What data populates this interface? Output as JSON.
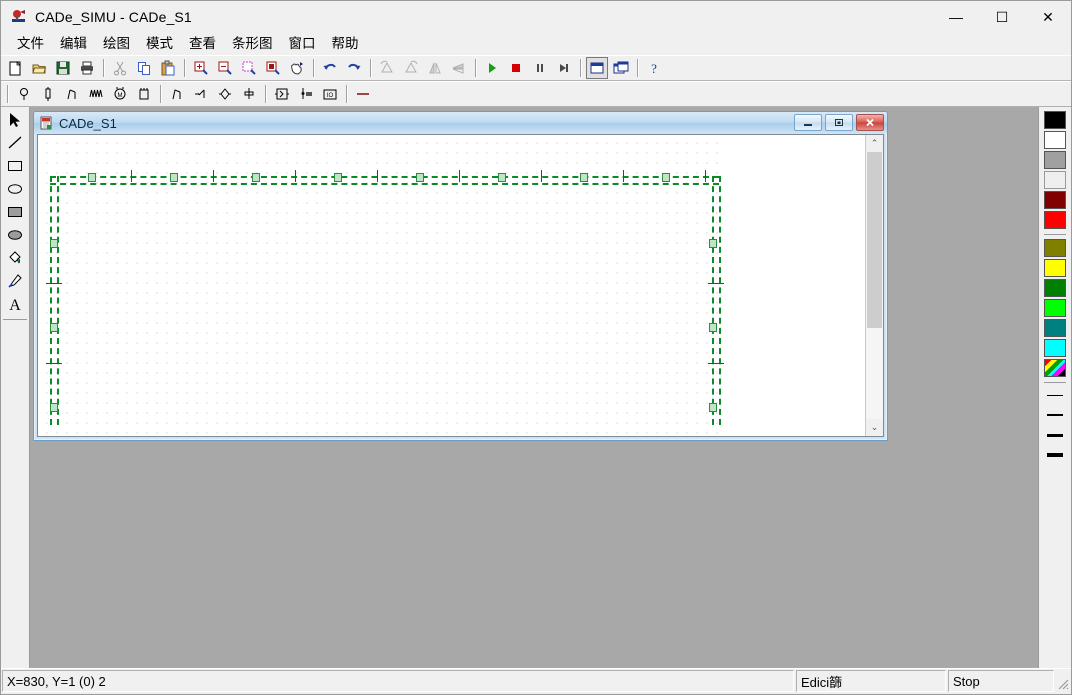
{
  "window": {
    "title": "CADe_SIMU - CADe_S1",
    "icon": "cade-simu-app-icon",
    "controls": {
      "minimize": "—",
      "maximize": "☐",
      "close": "✕"
    }
  },
  "menubar": {
    "items": [
      {
        "label": "文件",
        "name": "menu-file"
      },
      {
        "label": "编辑",
        "name": "menu-edit"
      },
      {
        "label": "绘图",
        "name": "menu-draw"
      },
      {
        "label": "模式",
        "name": "menu-mode"
      },
      {
        "label": "查看",
        "name": "menu-view"
      },
      {
        "label": "条形图",
        "name": "menu-bar-chart"
      },
      {
        "label": "窗口",
        "name": "menu-window"
      },
      {
        "label": "帮助",
        "name": "menu-help"
      }
    ]
  },
  "toolbar_main": {
    "buttons": [
      {
        "name": "new-icon",
        "tip": "New"
      },
      {
        "name": "open-icon",
        "tip": "Open"
      },
      {
        "name": "save-icon",
        "tip": "Save"
      },
      {
        "name": "print-icon",
        "tip": "Print"
      },
      {
        "name": "cut-icon",
        "tip": "Cut",
        "disabled": true
      },
      {
        "name": "copy-icon",
        "tip": "Copy"
      },
      {
        "name": "paste-icon",
        "tip": "Paste"
      },
      {
        "name": "zoom-in-icon",
        "tip": "Zoom In"
      },
      {
        "name": "zoom-out-icon",
        "tip": "Zoom Out"
      },
      {
        "name": "zoom-area-icon",
        "tip": "Zoom Area"
      },
      {
        "name": "zoom-page-icon",
        "tip": "Zoom Page"
      },
      {
        "name": "pan-icon",
        "tip": "Pan"
      },
      {
        "name": "undo-icon",
        "tip": "Undo"
      },
      {
        "name": "redo-icon",
        "tip": "Redo"
      },
      {
        "name": "rotate-left-icon",
        "tip": "Rotate Left",
        "disabled": true
      },
      {
        "name": "rotate-right-icon",
        "tip": "Rotate Right",
        "disabled": true
      },
      {
        "name": "flip-vertical-icon",
        "tip": "Flip Vertical",
        "disabled": true
      },
      {
        "name": "flip-horizontal-icon",
        "tip": "Flip Horizontal",
        "disabled": true
      },
      {
        "name": "run-icon",
        "tip": "Run Simulation"
      },
      {
        "name": "stop-icon",
        "tip": "Stop Simulation"
      },
      {
        "name": "pause-icon",
        "tip": "Pause"
      },
      {
        "name": "step-icon",
        "tip": "Step"
      },
      {
        "name": "window-single-icon",
        "tip": "Single Window",
        "pressed": true
      },
      {
        "name": "window-cascade-icon",
        "tip": "Cascade Windows"
      },
      {
        "name": "help-icon",
        "tip": "Help"
      }
    ]
  },
  "toolbar_components": {
    "buttons": [
      {
        "name": "lamp-icon",
        "tip": "Lamp"
      },
      {
        "name": "fuse-icon",
        "tip": "Fuse"
      },
      {
        "name": "switch-icon",
        "tip": "Switch"
      },
      {
        "name": "coil-icon",
        "tip": "Coil"
      },
      {
        "name": "motor-icon",
        "tip": "Motor"
      },
      {
        "name": "ic-chip-icon",
        "tip": "IC / PLC"
      },
      {
        "name": "contact-no-icon",
        "tip": "NO Contact"
      },
      {
        "name": "contact-aux-icon",
        "tip": "Aux Contact"
      },
      {
        "name": "valve-icon",
        "tip": "Valve"
      },
      {
        "name": "terminal-icon",
        "tip": "Terminal"
      },
      {
        "name": "relay-block-icon",
        "tip": "Relay Block"
      },
      {
        "name": "solenoid-icon",
        "tip": "Solenoid"
      },
      {
        "name": "io-module-icon",
        "tip": "IO Module"
      },
      {
        "name": "wire-icon",
        "tip": "Wire"
      }
    ]
  },
  "left_tools": {
    "buttons": [
      {
        "name": "select-arrow-icon",
        "tip": "Select"
      },
      {
        "name": "line-icon",
        "tip": "Line"
      },
      {
        "name": "rectangle-icon",
        "tip": "Rectangle"
      },
      {
        "name": "ellipse-icon",
        "tip": "Ellipse"
      },
      {
        "name": "filled-rectangle-icon",
        "tip": "Filled Rectangle"
      },
      {
        "name": "filled-ellipse-icon",
        "tip": "Filled Ellipse"
      },
      {
        "name": "fill-bucket-icon",
        "tip": "Fill"
      },
      {
        "name": "eyedropper-icon",
        "tip": "Pick Color"
      },
      {
        "name": "text-tool-icon",
        "tip": "Text"
      }
    ]
  },
  "palette": {
    "colors": [
      {
        "name": "color-black",
        "hex": "#000000"
      },
      {
        "name": "color-white",
        "hex": "#ffffff"
      },
      {
        "name": "color-gray",
        "hex": "#a0a0a0"
      },
      {
        "name": "color-light-gray",
        "hex": "#efefef"
      },
      {
        "name": "color-dark-red",
        "hex": "#800000"
      },
      {
        "name": "color-red",
        "hex": "#ff0000"
      },
      {
        "name": "color-olive",
        "hex": "#808000"
      },
      {
        "name": "color-yellow",
        "hex": "#ffff00"
      },
      {
        "name": "color-dark-green",
        "hex": "#008000"
      },
      {
        "name": "color-green",
        "hex": "#00ff00"
      },
      {
        "name": "color-teal",
        "hex": "#008080"
      },
      {
        "name": "color-cyan",
        "hex": "#00ffff"
      },
      {
        "name": "color-rainbow",
        "hex": "rainbow"
      }
    ],
    "line_widths": [
      1,
      2,
      3,
      4
    ]
  },
  "child_window": {
    "title": "CADe_S1",
    "icon": "document-icon",
    "controls": {
      "minimize": "–",
      "restore": "□",
      "close": "✕"
    },
    "scrollbar": {
      "up": "⌃",
      "down": "⌄",
      "thumb_percent": 66
    }
  },
  "statusbar": {
    "coordinates": "X=830, Y=1 (0) 2",
    "mode": "Edici篩",
    "sim_state": "Stop"
  }
}
